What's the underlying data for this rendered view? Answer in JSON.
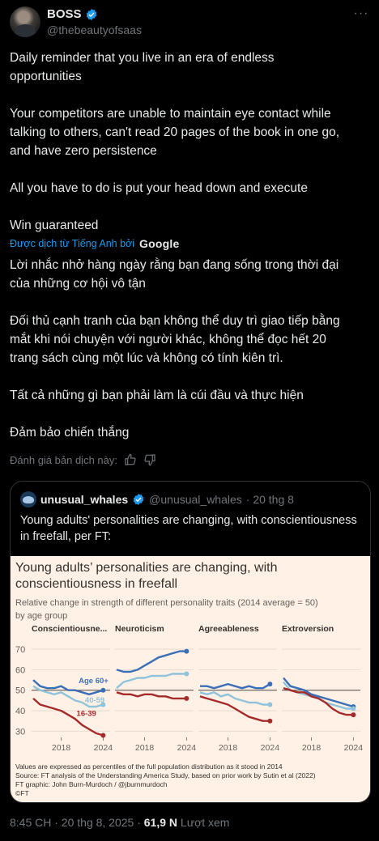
{
  "author": {
    "name": "BOSS",
    "handle": "@thebeautyofsaas"
  },
  "tweet": {
    "text": "Daily reminder that you live in an era of endless\nopportunities\n\nYour competitors are unable to maintain eye contact while\ntalking to others, can't read 20 pages of the book in one go,\nand have zero persistence\n\nAll you have to do is put your head down and execute\n\nWin guaranteed",
    "translated_by": "Được dịch từ Tiếng Anh bởi",
    "translator": "Google",
    "translation": "Lời nhắc nhở hàng ngày rằng bạn đang sống trong thời đại\ncủa những cơ hội vô tận\n\nĐối thủ cạnh tranh của bạn không thể duy trì giao tiếp bằng\nmắt khi nói chuyện với người khác, không thể đọc hết 20\ntrang sách cùng một lúc và không có tính kiên trì.\n\nTất cả những gì bạn phải làm là cúi đầu và thực hiện\n\nĐảm bảo chiến thắng",
    "rate_label": "Đánh giá bản dịch này:"
  },
  "quote": {
    "name": "unusual_whales",
    "handle": "@unusual_whales",
    "date": "· 20 thg 8",
    "text": "Young adults' personalities are changing, with conscientiousness in freefall, per FT:"
  },
  "chart_data": {
    "type": "line",
    "title": "Young adults’ personalities are changing, with conscientiousness in freefall",
    "subtitle": "Relative change in strength of different personality traits (2014 average = 50) by age group",
    "y_ticks": [
      30,
      40,
      50,
      60,
      70
    ],
    "ylim": [
      27,
      72
    ],
    "x_ticks": [
      "2018",
      "2024"
    ],
    "x_range": [
      2014,
      2025
    ],
    "reference_line": 50,
    "colors": {
      "age_60_plus": "#3a6fb7",
      "age_40_59": "#8fc3dc",
      "age_16_39": "#a52a2a"
    },
    "panels": [
      {
        "name": "Conscientiousne...",
        "series": [
          {
            "name": "Age 60+",
            "x": [
              2014,
              2015,
              2016,
              2017,
              2018,
              2019,
              2020,
              2021,
              2022,
              2023,
              2024
            ],
            "values": [
              55,
              52,
              51,
              51,
              52,
              50,
              50,
              49,
              48,
              49,
              50
            ]
          },
          {
            "name": "40-59",
            "x": [
              2014,
              2015,
              2016,
              2017,
              2018,
              2019,
              2020,
              2021,
              2022,
              2023,
              2024
            ],
            "values": [
              52,
              50,
              49,
              48,
              49,
              47,
              45,
              44,
              42,
              42,
              43
            ]
          },
          {
            "name": "16-39",
            "x": [
              2014,
              2015,
              2016,
              2017,
              2018,
              2019,
              2020,
              2021,
              2022,
              2023,
              2024
            ],
            "values": [
              46,
              43,
              42,
              41,
              40,
              38,
              36,
              33,
              31,
              29,
              28
            ]
          }
        ]
      },
      {
        "name": "Neuroticism",
        "series": [
          {
            "name": "",
            "x": [
              2014,
              2015,
              2016,
              2017,
              2018,
              2019,
              2020,
              2021,
              2022,
              2023,
              2024
            ],
            "values": [
              60,
              59,
              59,
              60,
              62,
              64,
              66,
              67,
              68,
              69,
              69
            ]
          },
          {
            "name": "",
            "x": [
              2014,
              2015,
              2016,
              2017,
              2018,
              2019,
              2020,
              2021,
              2022,
              2023,
              2024
            ],
            "values": [
              51,
              54,
              55,
              56,
              56,
              57,
              57,
              57,
              58,
              58,
              58
            ]
          },
          {
            "name": "",
            "x": [
              2014,
              2015,
              2016,
              2017,
              2018,
              2019,
              2020,
              2021,
              2022,
              2023,
              2024
            ],
            "values": [
              49,
              48,
              48,
              47,
              48,
              48,
              47,
              47,
              46,
              46,
              46
            ]
          }
        ]
      },
      {
        "name": "Agreeableness",
        "series": [
          {
            "name": "",
            "x": [
              2014,
              2015,
              2016,
              2017,
              2018,
              2019,
              2020,
              2021,
              2022,
              2023,
              2024
            ],
            "values": [
              52,
              52,
              51,
              52,
              53,
              52,
              51,
              52,
              51,
              51,
              53
            ]
          },
          {
            "name": "",
            "x": [
              2014,
              2015,
              2016,
              2017,
              2018,
              2019,
              2020,
              2021,
              2022,
              2023,
              2024
            ],
            "values": [
              49,
              48,
              49,
              47,
              48,
              46,
              45,
              44,
              44,
              43,
              43
            ]
          },
          {
            "name": "",
            "x": [
              2014,
              2015,
              2016,
              2017,
              2018,
              2019,
              2020,
              2021,
              2022,
              2023,
              2024
            ],
            "values": [
              47,
              46,
              45,
              44,
              43,
              41,
              39,
              37,
              36,
              35,
              35
            ]
          }
        ]
      },
      {
        "name": "Extroversion",
        "series": [
          {
            "name": "",
            "x": [
              2014,
              2015,
              2016,
              2017,
              2018,
              2019,
              2020,
              2021,
              2022,
              2023,
              2024
            ],
            "values": [
              56,
              52,
              51,
              50,
              48,
              47,
              46,
              45,
              44,
              43,
              42
            ]
          },
          {
            "name": "",
            "x": [
              2014,
              2015,
              2016,
              2017,
              2018,
              2019,
              2020,
              2021,
              2022,
              2023,
              2024
            ],
            "values": [
              54,
              50,
              49,
              48,
              47,
              46,
              44,
              43,
              42,
              41,
              41
            ]
          },
          {
            "name": "",
            "x": [
              2014,
              2015,
              2016,
              2017,
              2018,
              2019,
              2020,
              2021,
              2022,
              2023,
              2024
            ],
            "values": [
              51,
              50,
              49,
              49,
              47,
              46,
              44,
              41,
              39,
              38,
              38
            ]
          }
        ]
      }
    ],
    "footnotes": [
      "Values are expressed as percentiles of the full population distribution as it stood in 2014",
      "Source: FT analysis of the Understanding America Study, based on prior work by Sutin et al (2022)",
      "FT graphic: John Burn-Murdoch / @jburnmurdoch",
      "©FT"
    ]
  },
  "meta": {
    "time": "8:45 CH · 20 thg 8, 2025 ·",
    "views": "61,9 N",
    "views_label": "Lượt xem"
  }
}
